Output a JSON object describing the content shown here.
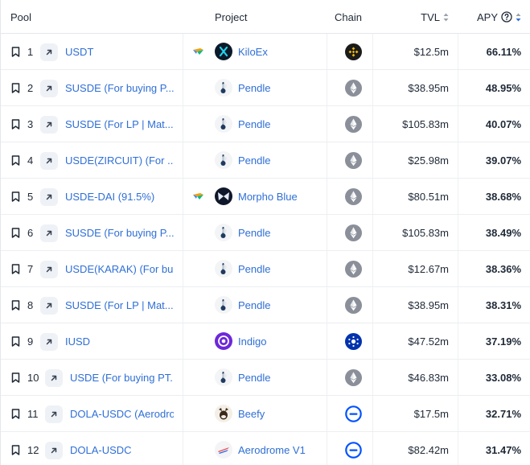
{
  "header": {
    "pool": "Pool",
    "project": "Project",
    "chain": "Chain",
    "tvl": "TVL",
    "apy": "APY"
  },
  "icons": {
    "bookmark": "bookmark-icon",
    "external": "arrow-up-right-icon",
    "boost": "boost-flag-icon",
    "sort": "sort-arrows-icon",
    "help": "question-circle-icon"
  },
  "colors": {
    "link": "#2f6fd6",
    "binance": "#f0b90b",
    "ethereum": "#8a8f99",
    "cardano": "#0033ad",
    "base": "#0052ff"
  },
  "rows": [
    {
      "rank": "1",
      "pool": "USDT",
      "boost": true,
      "project": "KiloEx",
      "project_logo": "kiloex",
      "chain": "binance",
      "tvl": "$12.5m",
      "apy": "66.11%"
    },
    {
      "rank": "2",
      "pool": "SUSDE (For buying P...",
      "boost": false,
      "project": "Pendle",
      "project_logo": "pendle",
      "chain": "ethereum",
      "tvl": "$38.95m",
      "apy": "48.95%"
    },
    {
      "rank": "3",
      "pool": "SUSDE (For LP | Mat...",
      "boost": false,
      "project": "Pendle",
      "project_logo": "pendle",
      "chain": "ethereum",
      "tvl": "$105.83m",
      "apy": "40.07%"
    },
    {
      "rank": "4",
      "pool": "USDE(ZIRCUIT) (For ...",
      "boost": false,
      "project": "Pendle",
      "project_logo": "pendle",
      "chain": "ethereum",
      "tvl": "$25.98m",
      "apy": "39.07%"
    },
    {
      "rank": "5",
      "pool": "USDE-DAI (91.5%)",
      "boost": true,
      "project": "Morpho Blue",
      "project_logo": "morpho",
      "chain": "ethereum",
      "tvl": "$80.51m",
      "apy": "38.68%"
    },
    {
      "rank": "6",
      "pool": "SUSDE (For buying P...",
      "boost": false,
      "project": "Pendle",
      "project_logo": "pendle",
      "chain": "ethereum",
      "tvl": "$105.83m",
      "apy": "38.49%"
    },
    {
      "rank": "7",
      "pool": "USDE(KARAK) (For bu...",
      "boost": false,
      "project": "Pendle",
      "project_logo": "pendle",
      "chain": "ethereum",
      "tvl": "$12.67m",
      "apy": "38.36%"
    },
    {
      "rank": "8",
      "pool": "SUSDE (For LP | Mat...",
      "boost": false,
      "project": "Pendle",
      "project_logo": "pendle",
      "chain": "ethereum",
      "tvl": "$38.95m",
      "apy": "38.31%"
    },
    {
      "rank": "9",
      "pool": "IUSD",
      "boost": false,
      "project": "Indigo",
      "project_logo": "indigo",
      "chain": "cardano",
      "tvl": "$47.52m",
      "apy": "37.19%"
    },
    {
      "rank": "10",
      "pool": "USDE (For buying PT...",
      "boost": false,
      "project": "Pendle",
      "project_logo": "pendle",
      "chain": "ethereum",
      "tvl": "$46.83m",
      "apy": "33.08%"
    },
    {
      "rank": "11",
      "pool": "DOLA-USDC (Aerodro...",
      "boost": false,
      "project": "Beefy",
      "project_logo": "beefy",
      "chain": "base",
      "tvl": "$17.5m",
      "apy": "32.71%"
    },
    {
      "rank": "12",
      "pool": "DOLA-USDC",
      "boost": false,
      "project": "Aerodrome V1",
      "project_logo": "aerodrome",
      "chain": "base",
      "tvl": "$82.42m",
      "apy": "31.47%"
    }
  ]
}
